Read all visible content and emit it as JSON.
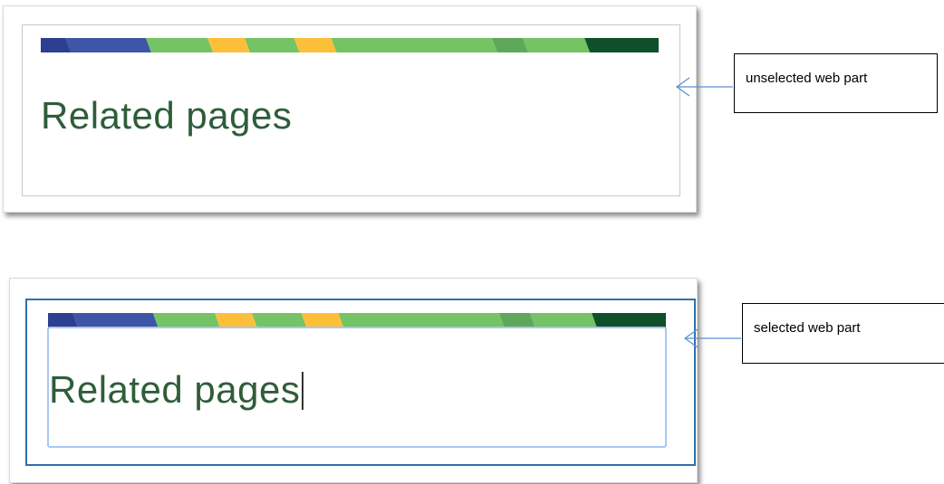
{
  "colors": {
    "title_text": "#2e5d3a",
    "selected_border": "#2f6fb0",
    "edit_box_border": "#a9c6f2",
    "arrow": "#5b8fd0"
  },
  "stripe_segments": [
    {
      "fraction": 0.04,
      "color": "#2c3f91"
    },
    {
      "fraction": 0.13,
      "color": "#3e55a8"
    },
    {
      "fraction": 0.1,
      "color": "#74c365"
    },
    {
      "fraction": 0.06,
      "color": "#fbbf3a"
    },
    {
      "fraction": 0.08,
      "color": "#74c365"
    },
    {
      "fraction": 0.06,
      "color": "#fbbf3a"
    },
    {
      "fraction": 0.26,
      "color": "#74c365"
    },
    {
      "fraction": 0.05,
      "color": "#5fa85a"
    },
    {
      "fraction": 0.1,
      "color": "#74c365"
    },
    {
      "fraction": 0.12,
      "color": "#0f4f2a"
    }
  ],
  "unselected": {
    "title": "Related pages",
    "label": "unselected web part"
  },
  "selected": {
    "title": "Related pages",
    "label": "selected web part"
  }
}
